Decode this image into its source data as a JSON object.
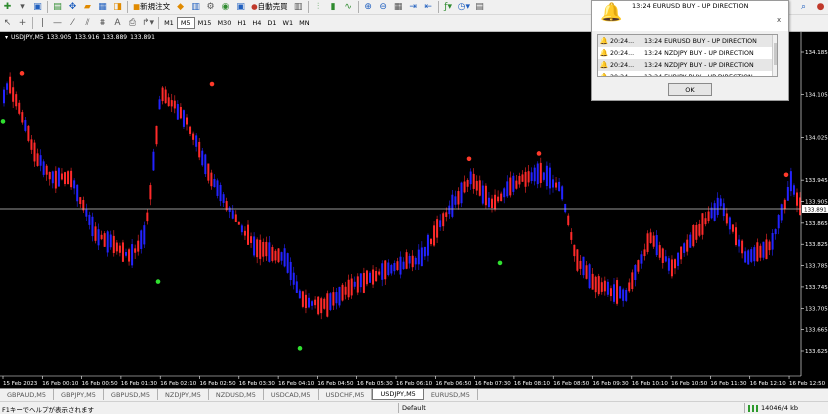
{
  "toolbar1": {
    "new_order_label": "新規注文",
    "auto_trading_label": "自動売買"
  },
  "toolbar2": {
    "timeframes": [
      "M1",
      "M5",
      "M15",
      "M30",
      "H1",
      "H4",
      "D1",
      "W1",
      "MN"
    ],
    "active_timeframe": "M5"
  },
  "chart": {
    "symbol_tf": "USDJPY,M5",
    "ohlc": [
      "133.905",
      "133.916",
      "133.889",
      "133.891"
    ],
    "price_labels": [
      "134.185",
      "134.105",
      "134.025",
      "133.945",
      "133.905",
      "133.865",
      "133.825",
      "133.785",
      "133.745",
      "133.705",
      "133.665",
      "133.625"
    ],
    "current_price": "133.891",
    "time_labels": [
      "15 Feb 2023",
      "16 Feb 00:10",
      "16 Feb 00:50",
      "16 Feb 01:30",
      "16 Feb 02:10",
      "16 Feb 02:50",
      "16 Feb 03:30",
      "16 Feb 04:10",
      "16 Feb 04:50",
      "16 Feb 05:30",
      "16 Feb 06:10",
      "16 Feb 06:50",
      "16 Feb 07:30",
      "16 Feb 08:10",
      "16 Feb 08:50",
      "16 Feb 09:30",
      "16 Feb 10:10",
      "16 Feb 10:50",
      "16 Feb 11:30",
      "16 Feb 12:10",
      "16 Feb 12:50"
    ],
    "colors": {
      "background": "#000000",
      "bull": "#2323ff",
      "bear": "#ff2a2a",
      "sell_signal": "#ff3a2a",
      "buy_signal": "#30e030",
      "price_line": "#c8c8c8"
    }
  },
  "alert": {
    "message": "13:24 EURUSD BUY - UP DIRECTION",
    "rows": [
      {
        "time": "20:24...",
        "text": "13:24 EURUSD BUY - UP DIRECTION"
      },
      {
        "time": "20:24...",
        "text": "13:24 NZDJPY BUY - UP DIRECTION"
      },
      {
        "time": "20:24...",
        "text": "13:24 NZDJPY BUY - UP DIRECTION"
      },
      {
        "time": "20:24...",
        "text": "13:24 EURJPY BUY - UP DIRECTION"
      }
    ],
    "ok_label": "OK",
    "close_glyph": "x"
  },
  "tabs": [
    "GBPAUD,M5",
    "GBPJPY,M5",
    "GBPUSD,M5",
    "NZDJPY,M5",
    "NZDUSD,M5",
    "USDCAD,M5",
    "USDCHF,M5",
    "USDJPY,M5",
    "EURUSD,M5"
  ],
  "active_tab": "USDJPY,M5",
  "status": {
    "help": "F1キーでヘルプが表示されます",
    "profile": "Default",
    "traffic": "14046/4 kb"
  }
}
